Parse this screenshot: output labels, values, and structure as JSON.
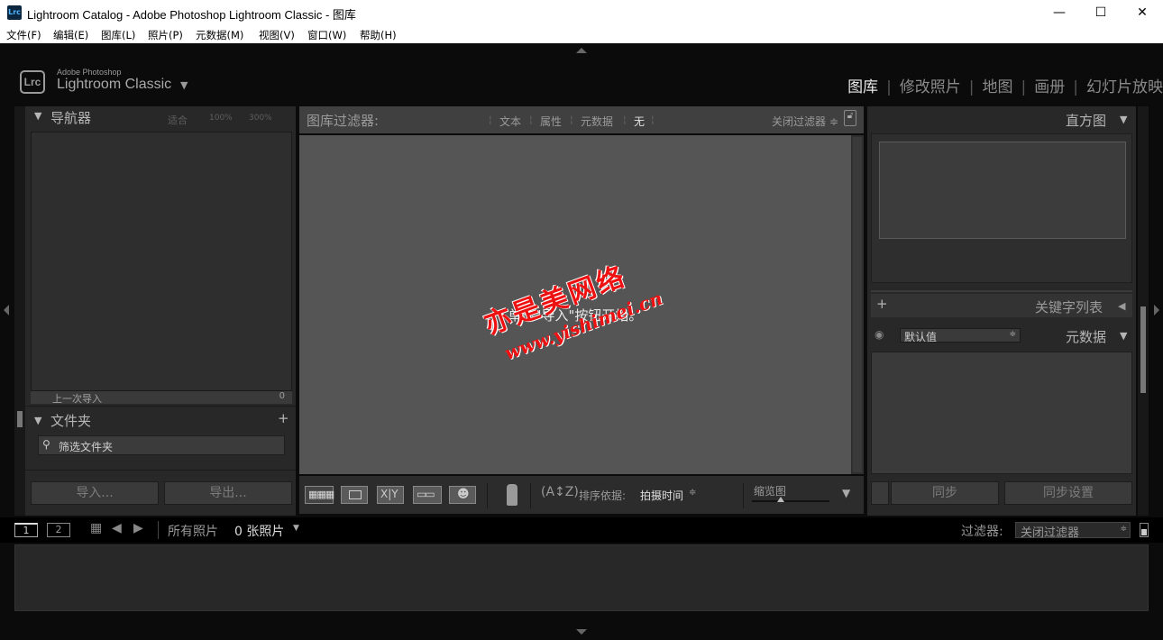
{
  "window": {
    "title": "Lightroom Catalog - Adobe Photoshop Lightroom Classic - 图库",
    "app_icon": "Lrc",
    "minimize": "—",
    "maximize": "☐",
    "close": "✕"
  },
  "menubar": [
    "文件(F)",
    "编辑(E)",
    "图库(L)",
    "照片(P)",
    "元数据(M)",
    "视图(V)",
    "窗口(W)",
    "帮助(H)"
  ],
  "identity": {
    "logo": "Lrc",
    "line1": "Adobe Photoshop",
    "line2": "Lightroom Classic",
    "caret": "▼"
  },
  "modules": [
    "图库",
    "修改照片",
    "地图",
    "画册",
    "幻灯片放映"
  ],
  "navigator": {
    "title": "导航器",
    "zoom": [
      "适合",
      "100%",
      "300%"
    ]
  },
  "catalog": {
    "last_import": "上一次导入",
    "count": "0"
  },
  "folders": {
    "title": "文件夹",
    "add": "+",
    "filter_placeholder": "筛选文件夹"
  },
  "left_buttons": {
    "import": "导入...",
    "export": "导出..."
  },
  "filter_bar": {
    "title": "图库过滤器:",
    "options": [
      "文本",
      "属性",
      "元数据",
      "无"
    ],
    "close_filter": "关闭过滤器 ≑"
  },
  "center": {
    "prompt": "单击\"导入\"按钮开始。"
  },
  "toolbar": {
    "sort_label": "排序依据:",
    "sort_value": "拍摄时间",
    "thumb_label": "缩览图"
  },
  "right": {
    "histogram": "直方图",
    "keywords": "关键字列表",
    "metadata": "元数据",
    "metadata_preset": "默认值",
    "sync": "同步",
    "sync_settings": "同步设置"
  },
  "filmstrip": {
    "view1": "1",
    "view2": "2",
    "source": "所有照片",
    "count": "0 张照片",
    "filter_label": "过滤器:",
    "filter_value": "关闭过滤器"
  },
  "watermark": {
    "line1": "亦是美网络",
    "line2": "www.yishimei.cn"
  },
  "colors": {
    "panel": "#2b2b2b",
    "background": "#0b0b0b",
    "grid": "#555555",
    "watermark": "#ee1111"
  }
}
